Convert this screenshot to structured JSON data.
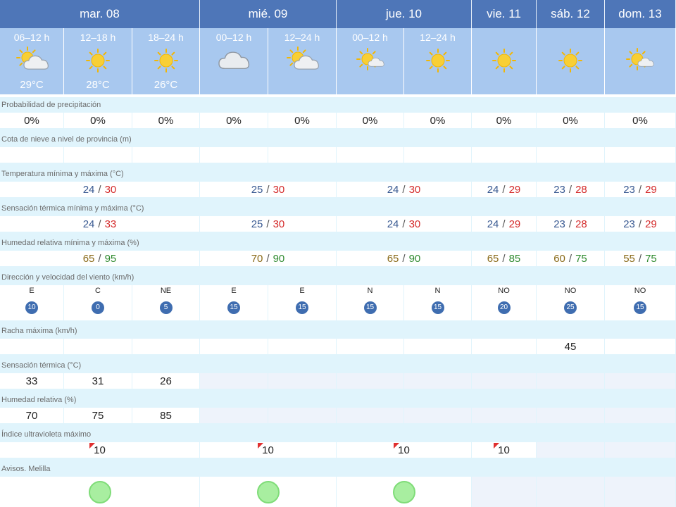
{
  "days": [
    {
      "label": "mar. 08"
    },
    {
      "label": "mié. 09"
    },
    {
      "label": "jue. 10"
    },
    {
      "label": "vie. 11"
    },
    {
      "label": "sáb. 12"
    },
    {
      "label": "dom. 13"
    }
  ],
  "periods": [
    {
      "label": "06–12 h",
      "temp": "29°C",
      "icon": "partly-cloudy-icon"
    },
    {
      "label": "12–18 h",
      "temp": "28°C",
      "icon": "sun-icon"
    },
    {
      "label": "18–24 h",
      "temp": "26°C",
      "icon": "sun-icon"
    },
    {
      "label": "00–12 h",
      "temp": "",
      "icon": "cloud-icon"
    },
    {
      "label": "12–24 h",
      "temp": "",
      "icon": "partly-cloudy-icon"
    },
    {
      "label": "00–12 h",
      "temp": "",
      "icon": "sun-small-cloud-icon"
    },
    {
      "label": "12–24 h",
      "temp": "",
      "icon": "sun-icon"
    },
    {
      "label": "",
      "temp": "",
      "icon": "sun-icon"
    },
    {
      "label": "",
      "temp": "",
      "icon": "sun-icon"
    },
    {
      "label": "",
      "temp": "",
      "icon": "sun-small-cloud-icon"
    }
  ],
  "rows": {
    "precip": {
      "label": "Probabilidad de precipitación",
      "values": [
        "0%",
        "0%",
        "0%",
        "0%",
        "0%",
        "0%",
        "0%",
        "0%",
        "0%",
        "0%"
      ]
    },
    "snow": {
      "label": "Cota de nieve a nivel de provincia (m)"
    },
    "temp": {
      "label": "Temperatura mínima y máxima (°C)",
      "values": [
        {
          "min": "24",
          "max": "30"
        },
        {
          "min": "25",
          "max": "30"
        },
        {
          "min": "24",
          "max": "30"
        },
        {
          "min": "24",
          "max": "29"
        },
        {
          "min": "23",
          "max": "28"
        },
        {
          "min": "23",
          "max": "29"
        }
      ]
    },
    "feels": {
      "label": "Sensación térmica mínima y máxima (°C)",
      "values": [
        {
          "min": "24",
          "max": "33"
        },
        {
          "min": "25",
          "max": "30"
        },
        {
          "min": "24",
          "max": "30"
        },
        {
          "min": "24",
          "max": "29"
        },
        {
          "min": "23",
          "max": "28"
        },
        {
          "min": "23",
          "max": "29"
        }
      ]
    },
    "humidity": {
      "label": "Humedad relativa mínima y máxima (%)",
      "values": [
        {
          "min": "65",
          "max": "95"
        },
        {
          "min": "70",
          "max": "90"
        },
        {
          "min": "65",
          "max": "90"
        },
        {
          "min": "65",
          "max": "85"
        },
        {
          "min": "60",
          "max": "75"
        },
        {
          "min": "55",
          "max": "75"
        }
      ]
    },
    "wind": {
      "label": "Dirección y velocidad del viento (km/h)",
      "values": [
        {
          "dir": "E",
          "speed": "10",
          "arrow": "left"
        },
        {
          "dir": "C",
          "speed": "0",
          "arrow": "none"
        },
        {
          "dir": "NE",
          "speed": "5",
          "arrow": "down-left"
        },
        {
          "dir": "E",
          "speed": "15",
          "arrow": "left"
        },
        {
          "dir": "E",
          "speed": "15",
          "arrow": "left"
        },
        {
          "dir": "N",
          "speed": "15",
          "arrow": "down"
        },
        {
          "dir": "N",
          "speed": "15",
          "arrow": "down"
        },
        {
          "dir": "NO",
          "speed": "20",
          "arrow": "down-right"
        },
        {
          "dir": "NO",
          "speed": "25",
          "arrow": "down-right"
        },
        {
          "dir": "NO",
          "speed": "15",
          "arrow": "down-right"
        }
      ]
    },
    "gust": {
      "label": "Racha máxima (km/h)",
      "values": [
        "",
        "",
        "",
        "",
        "",
        "",
        "",
        "",
        "45",
        ""
      ]
    },
    "feelsPeriod": {
      "label": "Sensación térmica (°C)",
      "values": [
        "33",
        "31",
        "26"
      ]
    },
    "humPeriod": {
      "label": "Humedad relativa (%)",
      "values": [
        "70",
        "75",
        "85"
      ]
    },
    "uv": {
      "label": "Índice ultravioleta máximo",
      "values": [
        "10",
        "10",
        "10",
        "10"
      ]
    },
    "avisos": {
      "label": "Avisos. Melilla",
      "values": [
        "green",
        "green",
        "green"
      ]
    }
  },
  "colors": {
    "header": "#4e76b8",
    "subheader": "#a8c8ef",
    "band": "#e0f4fc",
    "tmin": "#3a5a92",
    "tmax": "#d42a2a",
    "warning": "#a8eea0"
  }
}
